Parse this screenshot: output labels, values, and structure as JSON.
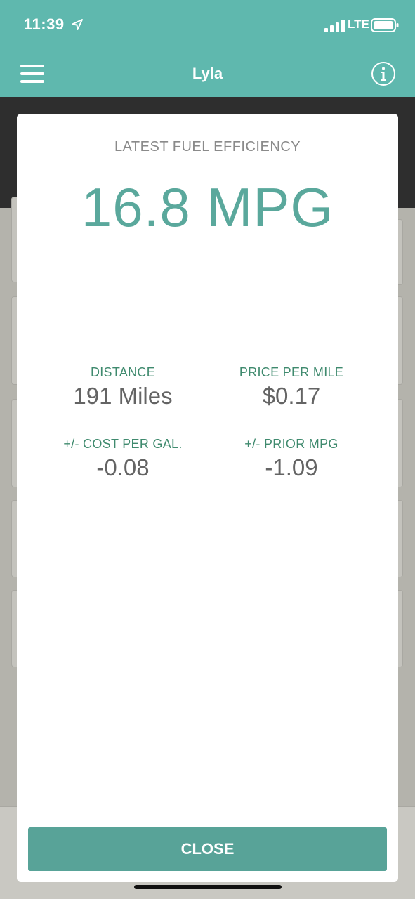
{
  "status_bar": {
    "time": "11:39",
    "network": "LTE",
    "icons": [
      "location-arrow-icon",
      "signal-bars-icon",
      "battery-icon"
    ]
  },
  "nav": {
    "title": "Lyla",
    "icons": [
      "menu-icon",
      "info-icon"
    ]
  },
  "modal": {
    "heading": "LATEST FUEL EFFICIENCY",
    "mpg": "16.8 MPG",
    "stats": [
      {
        "label": "DISTANCE",
        "value": "191 Miles"
      },
      {
        "label": "PRICE PER MILE",
        "value": "$0.17"
      },
      {
        "label": "+/- COST PER GAL.",
        "value": "-0.08"
      },
      {
        "label": "+/- PRIOR MPG",
        "value": "-1.09"
      }
    ],
    "close_label": "CLOSE"
  },
  "colors": {
    "brand_teal": "#5fb8ae",
    "accent_value": "#5aa89c",
    "stat_label": "#3f8a6e",
    "button": "#58a398"
  }
}
